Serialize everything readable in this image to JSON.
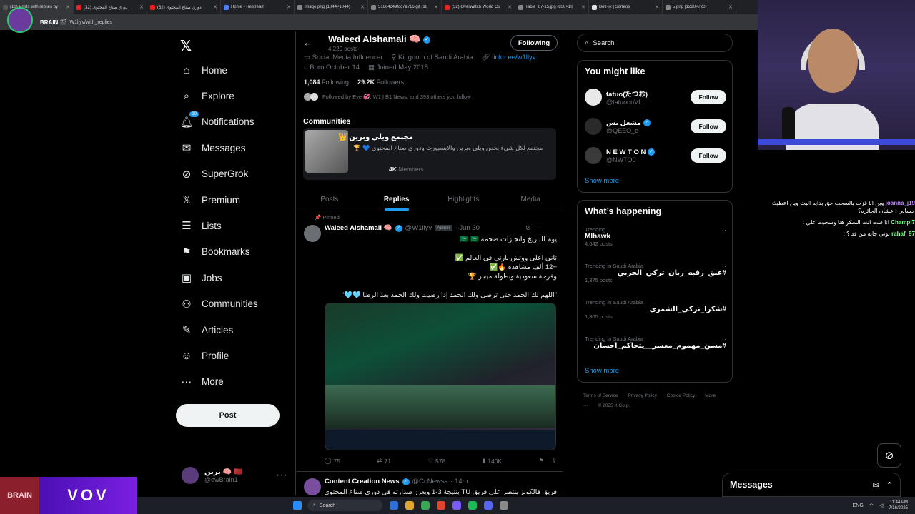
{
  "browser": {
    "tabs": [
      {
        "title": "(10) Posts with replies by",
        "color": "#555"
      },
      {
        "title": "دوري صناع المحتوى (32)",
        "color": "#e22"
      },
      {
        "title": "دوري صناع المحتوى (32)",
        "color": "#e22"
      },
      {
        "title": "Home - Restream",
        "color": "#4a7dff"
      },
      {
        "title": "image.png (1044×1044)",
        "color": "#888"
      },
      {
        "title": "51664c49fcc7a716.gif (16",
        "color": "#888"
      },
      {
        "title": "(32) Overwatch World Cu",
        "color": "#e22"
      },
      {
        "title": "Table_07-15.jpg (836×10",
        "color": "#888"
      },
      {
        "title": "BotRix | Sorteos",
        "color": "#ddd"
      },
      {
        "title": "5.png (1280×720)",
        "color": "#888"
      }
    ],
    "address_label": "BRAIN 🎬",
    "address_url": "W1llyv/with_replies"
  },
  "nav": {
    "logo": "𝕏",
    "items": [
      {
        "label": "Home",
        "icon": "⌂"
      },
      {
        "label": "Explore",
        "icon": "⌕"
      },
      {
        "label": "Notifications",
        "icon": "🔔︎",
        "badge": "10"
      },
      {
        "label": "Messages",
        "icon": "✉"
      },
      {
        "label": "SuperGrok",
        "icon": "⊘"
      },
      {
        "label": "Premium",
        "icon": "𝕏"
      },
      {
        "label": "Lists",
        "icon": "☰"
      },
      {
        "label": "Bookmarks",
        "icon": "⚑"
      },
      {
        "label": "Jobs",
        "icon": "▣"
      },
      {
        "label": "Communities",
        "icon": "⚇"
      },
      {
        "label": "Articles",
        "icon": "✎"
      },
      {
        "label": "Profile",
        "icon": "☺"
      },
      {
        "label": "More",
        "icon": "⋯"
      }
    ],
    "post_label": "Post",
    "account": {
      "name": "برين 🧠 🇲🇦",
      "handle": "@owBrain1",
      "more": "···"
    }
  },
  "profile": {
    "back": "←",
    "name": "Waleed Alshamali 🧠",
    "posts_count": "4,220 posts",
    "following_button": "Following",
    "category": "Social Media Influencer",
    "location": "Kingdom of Saudi Arabia",
    "link": "linktr.ee/w1llyv",
    "born": "Born October 14",
    "joined": "Joined May 2018",
    "following_count": "1,084",
    "following_label": "Following",
    "followers_count": "29.2K",
    "followers_label": "Followers",
    "followed_by": "Followed by Eve 💞, W1 | B1 News, and 393 others you follow"
  },
  "community": {
    "section_title": "Communities",
    "name": "مجتمع ويلي وبرين 👑",
    "description": "مجتمع لكل شيء يخص ويلي وبرين والايسبورت ودوري صناع المحتوى 💙 🏆",
    "members_count": "4K",
    "members_label": "Members"
  },
  "tabs": [
    {
      "label": "Posts",
      "active": false
    },
    {
      "label": "Replies",
      "active": true
    },
    {
      "label": "Highlights",
      "active": false
    },
    {
      "label": "Media",
      "active": false
    }
  ],
  "tweet": {
    "pinned_label": "📌 Pinned",
    "author": "Waleed Alshamali 🧠",
    "handle": "@W1llyv",
    "admin_badge": "Admin",
    "date": "· Jun 30",
    "text": "يوم للتاريخ وانجازات ضخمة 🇸🇦 🇸🇦\n\nثاني اعلى ووتش بارتي في العالم ✅\n+12 ألف مشاهدة 🔥✅\nوفرحة سعودية وبطولة ميجر 🏆\n\n\"اللهم لك الحمد حتى ترضى ولك الحمد إذا رضيت ولك الحمد بعد الرضا 🩵🩵\"",
    "replies": "75",
    "reposts": "71",
    "likes": "578",
    "views": "140K"
  },
  "tweet2": {
    "author": "Content Creation News",
    "handle": "@CcNewss",
    "date": "· 14m",
    "text": "فريق فالكونز ينتصر على فريق TU بنتيجة 3-1 ويعزز صدارته في دوري صناع المحتوى بـ"
  },
  "sidebar": {
    "search_placeholder": "Search",
    "might_like_title": "You might like",
    "suggestions": [
      {
        "name": "tatuo(たつお)",
        "handle": "@tatuoooVL",
        "button": "Follow",
        "verified": false
      },
      {
        "name": "مشعل بس",
        "handle": "@QEEO_o",
        "button": "Follow",
        "verified": true
      },
      {
        "name": "N E W T O N",
        "handle": "@NWTO0",
        "button": "Follow",
        "verified": true
      }
    ],
    "show_more": "Show more",
    "happening_title": "What’s happening",
    "trends": [
      {
        "context": "Trending",
        "title": "Mlhawk",
        "posts": "4,642 posts"
      },
      {
        "context": "Trending in Saudi Arabia",
        "title": "#عنق_رقبه_ربان_تركي_الحربي",
        "posts": "1,375 posts"
      },
      {
        "context": "Trending in Saudi Arabia",
        "title": "#شكرا_تركي_الشمري",
        "posts": "1,305 posts"
      },
      {
        "context": "Trending in Saudi Arabia",
        "title": "#مسن_مهموم_معسر__يتحاكم_احسان",
        "posts": ""
      }
    ],
    "footer": [
      "Terms of Service",
      "Privacy Policy",
      "Cookie Policy",
      "More ···",
      "© 2025 X Corp."
    ]
  },
  "messages_drawer": {
    "title": "Messages"
  },
  "stream_chat": [
    {
      "user": "joanna_j19",
      "msg": "وين انا قزت بالسحب حق بدايه البث وين اعطيك حسابي : عشان الجائزه؟"
    },
    {
      "user": "Champi7",
      "msg": "انا قلت انت السكر هنا وسحبت علي :"
    },
    {
      "user": "rahaf_97",
      "msg": "توني جايه من قد ؟ :"
    }
  ],
  "overlay": {
    "brand_logo": "BRAIN",
    "vov_logo": "VOV"
  },
  "taskbar": {
    "search": "Search",
    "lang": "ENG",
    "time": "11:44 PM",
    "date": "7/16/2025"
  }
}
